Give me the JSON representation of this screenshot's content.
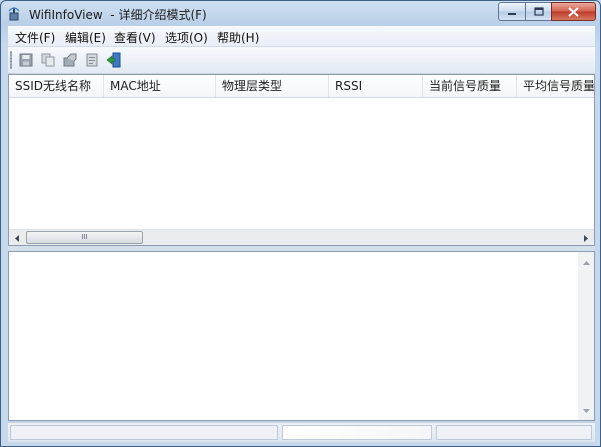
{
  "window": {
    "title": "WifiInfoView  - 详细介绍模式(F)",
    "controls": {
      "minimize": "minimize",
      "maximize": "maximize",
      "close": "close"
    }
  },
  "menu": {
    "items": [
      {
        "label": "文件(F)"
      },
      {
        "label": "编辑(E)"
      },
      {
        "label": "查看(V)"
      },
      {
        "label": "选项(O)"
      },
      {
        "label": "帮助(H)"
      }
    ]
  },
  "toolbar": {
    "buttons": [
      {
        "icon": "save-icon"
      },
      {
        "icon": "copy-icon"
      },
      {
        "icon": "properties-icon"
      },
      {
        "icon": "html-report-icon"
      },
      {
        "icon": "exit-icon"
      }
    ]
  },
  "table": {
    "columns": [
      "SSID无线名称",
      "MAC地址",
      "物理层类型",
      "RSSI",
      "当前信号质量",
      "平均信号质量"
    ],
    "rows": []
  },
  "scrollbar": {
    "grip_label": "III"
  },
  "status": {
    "text": ""
  },
  "colors": {
    "accent": "#3e5f86",
    "close": "#c0392b"
  }
}
